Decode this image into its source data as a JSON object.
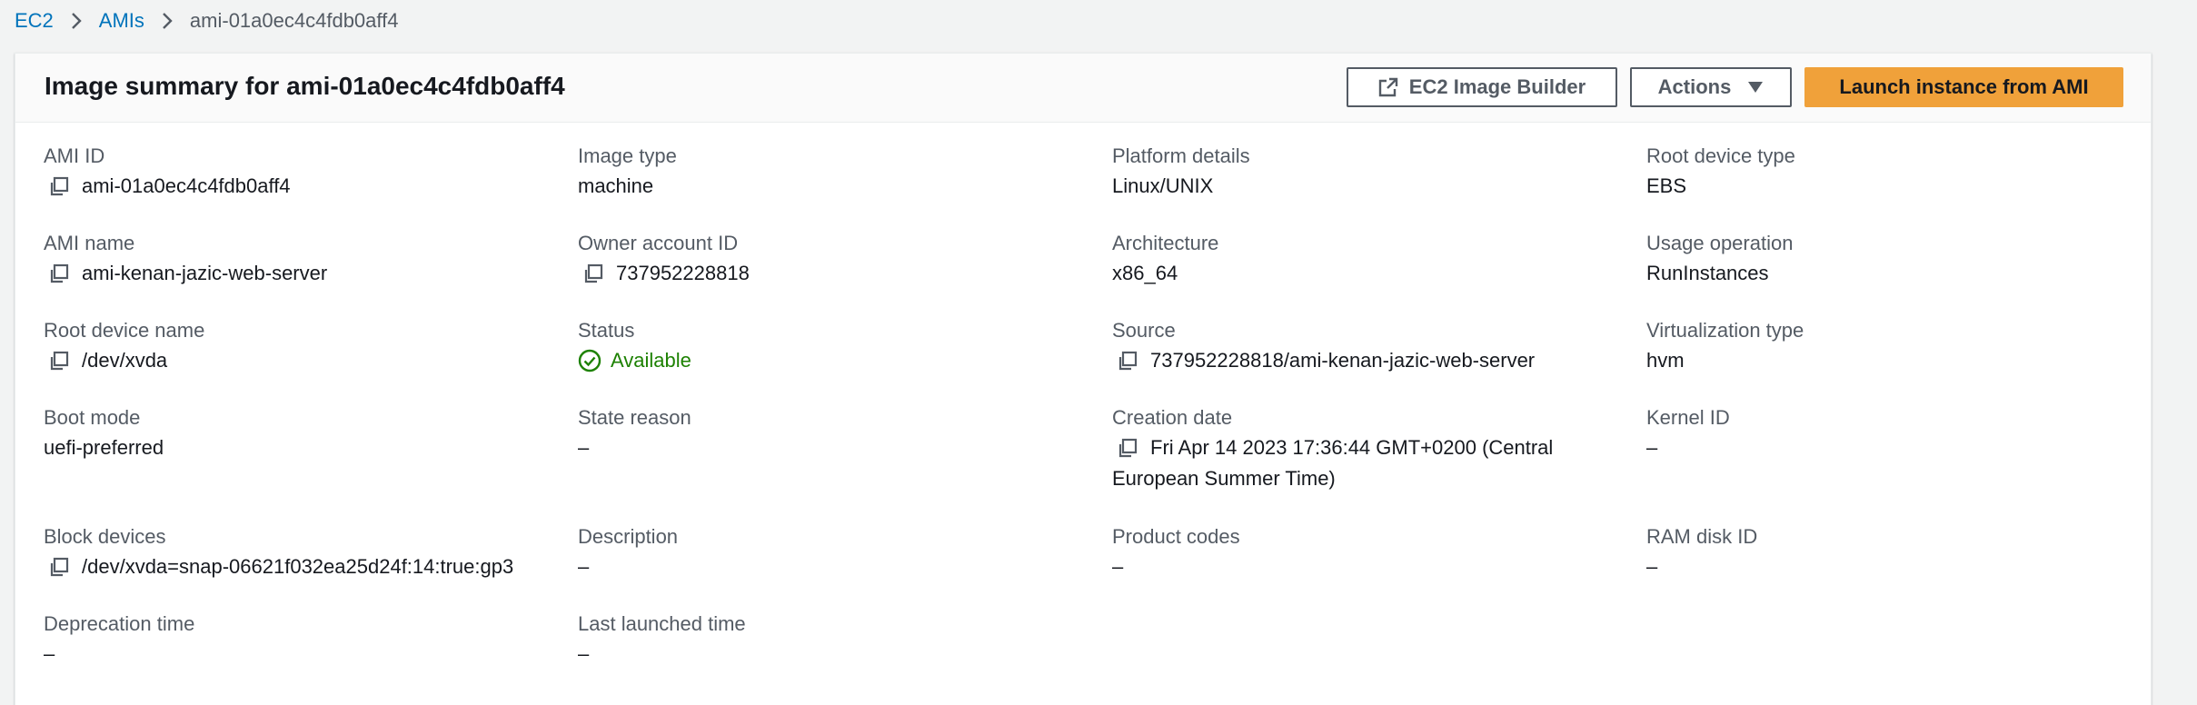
{
  "breadcrumb": {
    "items": [
      {
        "label": "EC2"
      },
      {
        "label": "AMIs"
      },
      {
        "label": "ami-01a0ec4c4fdb0aff4"
      }
    ]
  },
  "panel": {
    "title": "Image summary for ami-01a0ec4c4fdb0aff4",
    "buttons": {
      "builder": "EC2 Image Builder",
      "actions": "Actions",
      "launch": "Launch instance from AMI"
    }
  },
  "details": {
    "ami_id": {
      "label": "AMI ID",
      "value": "ami-01a0ec4c4fdb0aff4"
    },
    "image_type": {
      "label": "Image type",
      "value": "machine"
    },
    "platform_details": {
      "label": "Platform details",
      "value": "Linux/UNIX"
    },
    "root_device_type": {
      "label": "Root device type",
      "value": "EBS"
    },
    "ami_name": {
      "label": "AMI name",
      "value": "ami-kenan-jazic-web-server"
    },
    "owner_account_id": {
      "label": "Owner account ID",
      "value": "737952228818"
    },
    "architecture": {
      "label": "Architecture",
      "value": "x86_64"
    },
    "usage_operation": {
      "label": "Usage operation",
      "value": "RunInstances"
    },
    "root_device_name": {
      "label": "Root device name",
      "value": "/dev/xvda"
    },
    "status": {
      "label": "Status",
      "value": "Available"
    },
    "source": {
      "label": "Source",
      "value": "737952228818/ami-kenan-jazic-web-server"
    },
    "virtualization_type": {
      "label": "Virtualization type",
      "value": "hvm"
    },
    "boot_mode": {
      "label": "Boot mode",
      "value": "uefi-preferred"
    },
    "state_reason": {
      "label": "State reason",
      "value": "–"
    },
    "creation_date": {
      "label": "Creation date",
      "value": "Fri Apr 14 2023 17:36:44 GMT+0200 (Central European Summer Time)"
    },
    "kernel_id": {
      "label": "Kernel ID",
      "value": "–"
    },
    "block_devices": {
      "label": "Block devices",
      "value": "/dev/xvda=snap-06621f032ea25d24f:14:true:gp3"
    },
    "description": {
      "label": "Description",
      "value": "–"
    },
    "product_codes": {
      "label": "Product codes",
      "value": "–"
    },
    "ram_disk_id": {
      "label": "RAM disk ID",
      "value": "–"
    },
    "deprecation_time": {
      "label": "Deprecation time",
      "value": "–"
    },
    "last_launched_time": {
      "label": "Last launched time",
      "value": "–"
    }
  },
  "icons": {
    "copy": "copy-icon",
    "status_ok": "check-circle-icon",
    "external": "external-link-icon",
    "caret": "caret-down-icon",
    "chevron": "chevron-right-icon"
  },
  "colors": {
    "link": "#0073bb",
    "primary_button": "#f0a13a",
    "status_available": "#1d8102"
  }
}
